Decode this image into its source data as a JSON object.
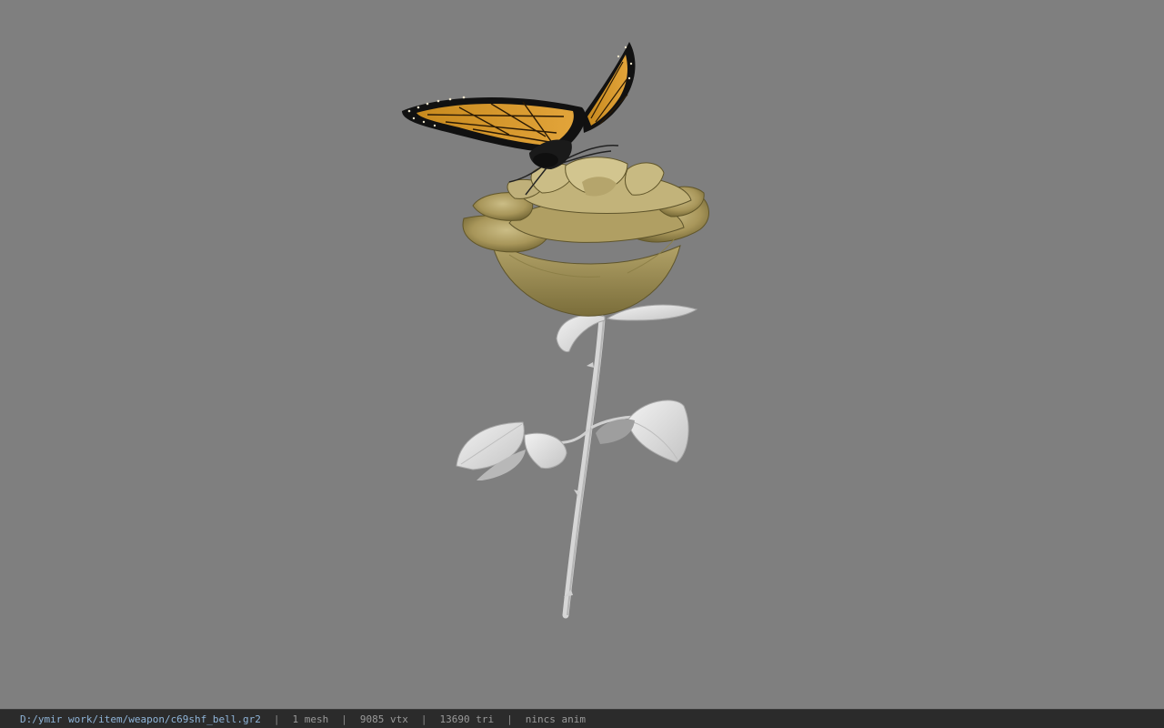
{
  "viewport": {
    "background": "#7f7f7f",
    "model": "yellow rose with butterfly"
  },
  "status_bar": {
    "file_path": "D:/ymir work/item/weapon/c69shf_bell.gr2",
    "mesh_count": "1 mesh",
    "vertex_count": "9085 vtx",
    "triangle_count": "13690 tri",
    "anim_status": "nincs anim",
    "separator": "|"
  }
}
